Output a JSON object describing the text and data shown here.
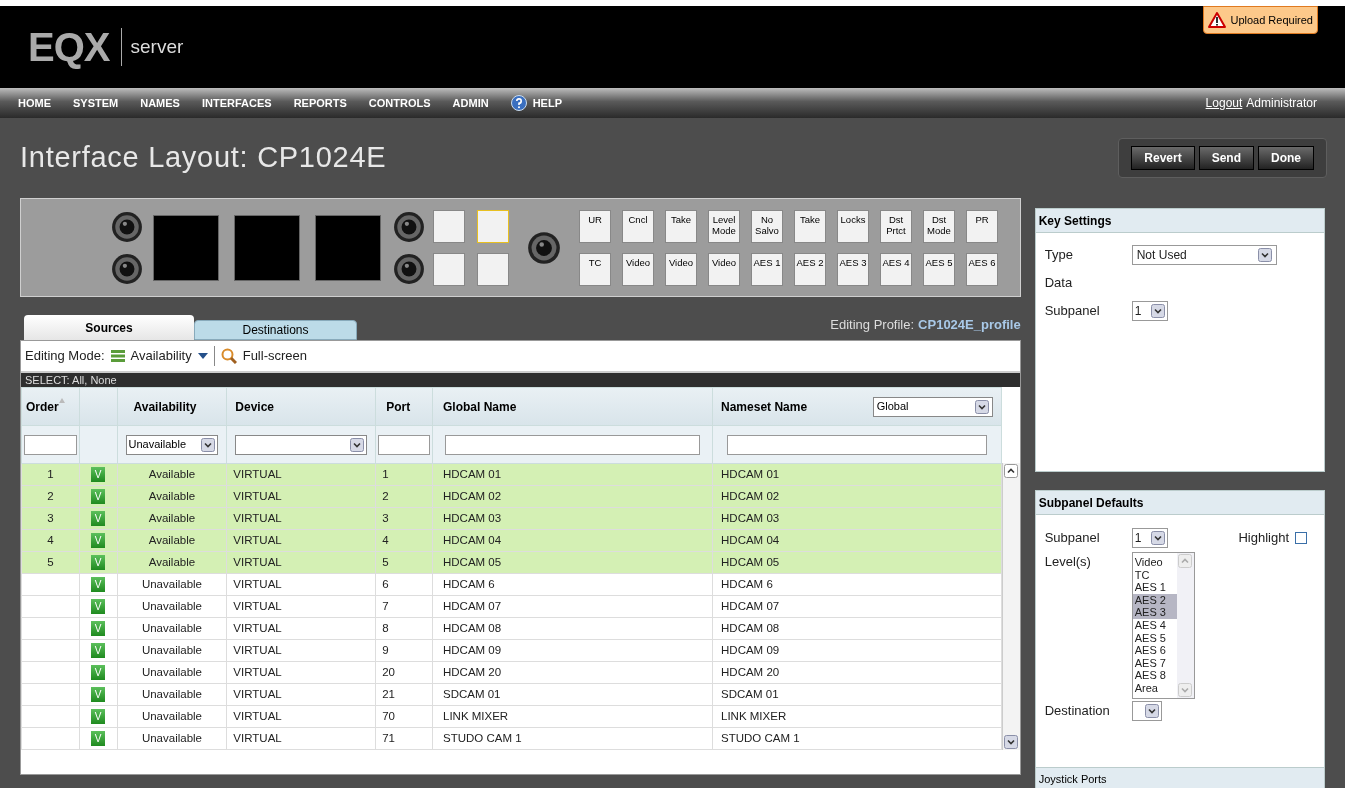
{
  "header": {
    "logo": "EQX",
    "product": "server",
    "alert": "Upload Required"
  },
  "nav": {
    "items": [
      "HOME",
      "SYSTEM",
      "NAMES",
      "INTERFACES",
      "REPORTS",
      "CONTROLS",
      "ADMIN",
      "HELP"
    ],
    "logout": "Logout",
    "user": "Administrator"
  },
  "title": "Interface Layout: CP1024E",
  "actions": [
    "Revert",
    "Send",
    "Done"
  ],
  "panel": {
    "blank_keys": [
      {
        "selected": false
      },
      {
        "selected": true
      },
      {
        "selected": false
      },
      {
        "selected": false
      }
    ],
    "top_keys": [
      "UR",
      "Cncl",
      "Take",
      "Level Mode",
      "No Salvo",
      "Take",
      "Locks",
      "Dst Prtct",
      "Dst Mode",
      "PR"
    ],
    "bottom_keys": [
      "TC",
      "Video",
      "Video",
      "Video",
      "AES 1",
      "AES 2",
      "AES 3",
      "AES 4",
      "AES 5",
      "AES 6"
    ]
  },
  "tabs": [
    {
      "label": "Sources",
      "selected": true
    },
    {
      "label": "Destinations",
      "selected": false
    }
  ],
  "editing_profile": {
    "label": "Editing Profile:",
    "value": "CP1024E_profile"
  },
  "toolbar": {
    "label": "Editing Mode:",
    "mode": "Availability",
    "fullscreen": "Full-screen"
  },
  "select_bar": "SELECT: All, None",
  "table": {
    "columns": [
      "Order",
      "Availability",
      "Device",
      "Port",
      "Global Name",
      "Nameset Name"
    ],
    "nameset_select": "Global",
    "availability_filter": "Unavailable",
    "rows": [
      {
        "order": "1",
        "badge": "V",
        "availability": "Available",
        "device": "VIRTUAL",
        "port": "1",
        "global_name": "HDCAM 01",
        "nameset_name": "HDCAM 01",
        "highlighted": true
      },
      {
        "order": "2",
        "badge": "V",
        "availability": "Available",
        "device": "VIRTUAL",
        "port": "2",
        "global_name": "HDCAM 02",
        "nameset_name": "HDCAM 02",
        "highlighted": true
      },
      {
        "order": "3",
        "badge": "V",
        "availability": "Available",
        "device": "VIRTUAL",
        "port": "3",
        "global_name": "HDCAM 03",
        "nameset_name": "HDCAM 03",
        "highlighted": true
      },
      {
        "order": "4",
        "badge": "V",
        "availability": "Available",
        "device": "VIRTUAL",
        "port": "4",
        "global_name": "HDCAM 04",
        "nameset_name": "HDCAM 04",
        "highlighted": true
      },
      {
        "order": "5",
        "badge": "V",
        "availability": "Available",
        "device": "VIRTUAL",
        "port": "5",
        "global_name": "HDCAM 05",
        "nameset_name": "HDCAM 05",
        "highlighted": true
      },
      {
        "badge": "V",
        "availability": "Unavailable",
        "device": "VIRTUAL",
        "port": "6",
        "global_name": "HDCAM 6",
        "nameset_name": "HDCAM 6",
        "highlighted": false
      },
      {
        "badge": "V",
        "availability": "Unavailable",
        "device": "VIRTUAL",
        "port": "7",
        "global_name": "HDCAM 07",
        "nameset_name": "HDCAM 07",
        "highlighted": false
      },
      {
        "badge": "V",
        "availability": "Unavailable",
        "device": "VIRTUAL",
        "port": "8",
        "global_name": "HDCAM 08",
        "nameset_name": "HDCAM 08",
        "highlighted": false
      },
      {
        "badge": "V",
        "availability": "Unavailable",
        "device": "VIRTUAL",
        "port": "9",
        "global_name": "HDCAM 09",
        "nameset_name": "HDCAM 09",
        "highlighted": false
      },
      {
        "badge": "V",
        "availability": "Unavailable",
        "device": "VIRTUAL",
        "port": "20",
        "global_name": "HDCAM 20",
        "nameset_name": "HDCAM 20",
        "highlighted": false
      },
      {
        "badge": "V",
        "availability": "Unavailable",
        "device": "VIRTUAL",
        "port": "21",
        "global_name": "SDCAM 01",
        "nameset_name": "SDCAM 01",
        "highlighted": false
      },
      {
        "badge": "V",
        "availability": "Unavailable",
        "device": "VIRTUAL",
        "port": "70",
        "global_name": "LINK MIXER",
        "nameset_name": "LINK MIXER",
        "highlighted": false
      },
      {
        "badge": "V",
        "availability": "Unavailable",
        "device": "VIRTUAL",
        "port": "71",
        "global_name": "STUDO CAM 1",
        "nameset_name": "STUDO CAM 1",
        "highlighted": false
      }
    ]
  },
  "key_settings": {
    "title": "Key Settings",
    "type_label": "Type",
    "type_value": "Not Used",
    "data_label": "Data",
    "subpanel_label": "Subpanel",
    "subpanel_value": "1"
  },
  "subpanel_defaults": {
    "title": "Subpanel Defaults",
    "subpanel_label": "Subpanel",
    "subpanel_value": "1",
    "highlight_label": "Highlight",
    "highlight_checked": false,
    "levels_label": "Level(s)",
    "levels": [
      {
        "label": "Video",
        "selected": false
      },
      {
        "label": "TC",
        "selected": false
      },
      {
        "label": "AES 1",
        "selected": false
      },
      {
        "label": "AES 2",
        "selected": true
      },
      {
        "label": "AES 3",
        "selected": true
      },
      {
        "label": "AES 4",
        "selected": false
      },
      {
        "label": "AES 5",
        "selected": false
      },
      {
        "label": "AES 6",
        "selected": false
      },
      {
        "label": "AES 7",
        "selected": false
      },
      {
        "label": "AES 8",
        "selected": false
      },
      {
        "label": "Area",
        "selected": false
      }
    ],
    "destination_label": "Destination",
    "footer": "Joystick Ports"
  }
}
